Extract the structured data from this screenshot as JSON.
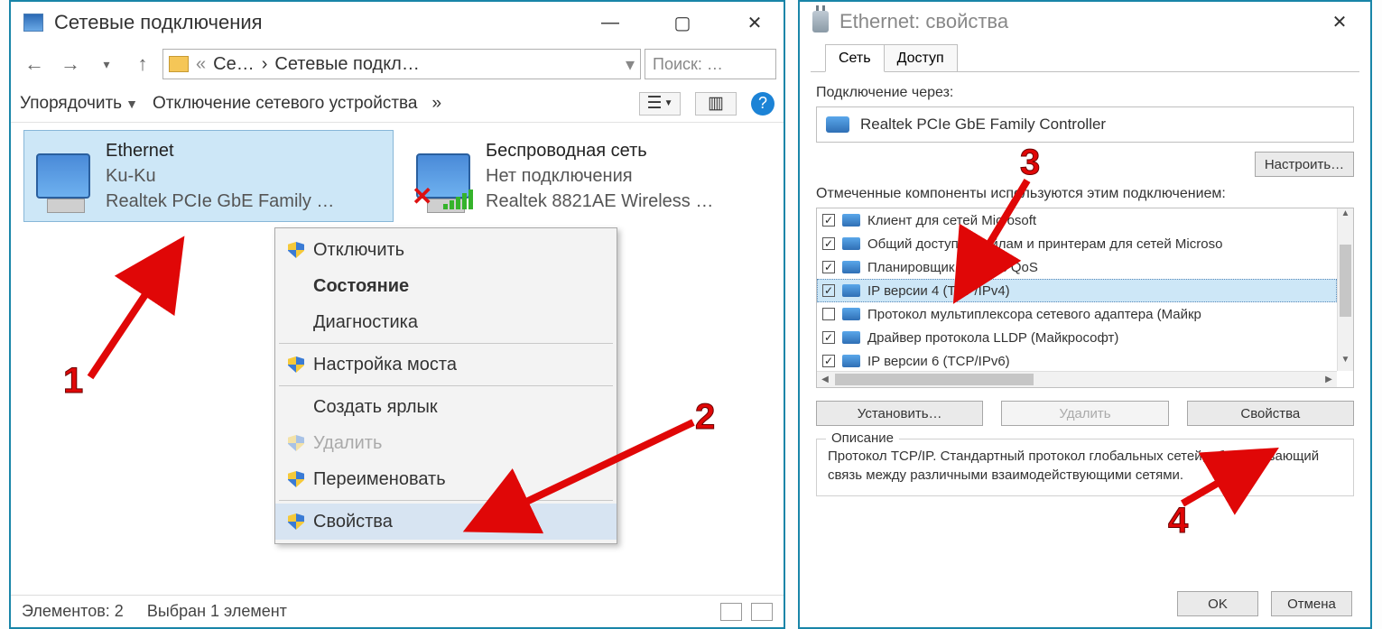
{
  "left_window": {
    "title": "Сетевые подключения",
    "nav": {
      "crumb1": "Се…",
      "crumb2": "Сетевые подкл…",
      "search_placeholder": "Поиск: …"
    },
    "toolbar": {
      "sort": "Упорядочить",
      "disable": "Отключение сетевого устройства"
    },
    "connections": {
      "ethernet": {
        "name": "Ethernet",
        "network": "Ku-Ku",
        "adapter": "Realtek PCIe GbE Family …"
      },
      "wifi": {
        "name": "Беспроводная сеть",
        "network": "Нет подключения",
        "adapter": "Realtek 8821AE Wireless …"
      }
    },
    "context_menu": {
      "disable": "Отключить",
      "status": "Состояние",
      "diagnose": "Диагностика",
      "bridge": "Настройка моста",
      "shortcut": "Создать ярлык",
      "delete": "Удалить",
      "rename": "Переименовать",
      "properties": "Свойства"
    },
    "statusbar": {
      "elements": "Элементов: 2",
      "selected": "Выбран 1 элемент"
    }
  },
  "right_window": {
    "title": "Ethernet: свойства",
    "tabs": {
      "network": "Сеть",
      "access": "Доступ"
    },
    "connect_via": {
      "label": "Подключение через:",
      "value": "Realtek PCIe GbE Family Controller"
    },
    "configure": "Настроить…",
    "components_label": "Отмеченные компоненты используются этим подключением:",
    "components": [
      {
        "checked": true,
        "label": "Клиент для сетей Microsoft"
      },
      {
        "checked": true,
        "label": "Общий доступ к файлам и принтерам для сетей Microso"
      },
      {
        "checked": true,
        "label": "Планировщик пакетов QoS"
      },
      {
        "checked": true,
        "label": "IP версии 4 (TCP/IPv4)"
      },
      {
        "checked": false,
        "label": "Протокол мультиплексора сетевого адаптера (Майкр"
      },
      {
        "checked": true,
        "label": "Драйвер протокола LLDP (Майкрософт)"
      },
      {
        "checked": true,
        "label": "IP версии 6 (TCP/IPv6)"
      }
    ],
    "buttons": {
      "install": "Установить…",
      "remove": "Удалить",
      "properties": "Свойства"
    },
    "desc_label": "Описание",
    "desc_text": "Протокол TCP/IP. Стандартный протокол глобальных сетей, обеспечивающий связь между различными взаимодействующими сетями.",
    "ok": "OK",
    "cancel": "Отмена"
  },
  "annotations": {
    "n1": "1",
    "n2": "2",
    "n3": "3",
    "n4": "4"
  }
}
